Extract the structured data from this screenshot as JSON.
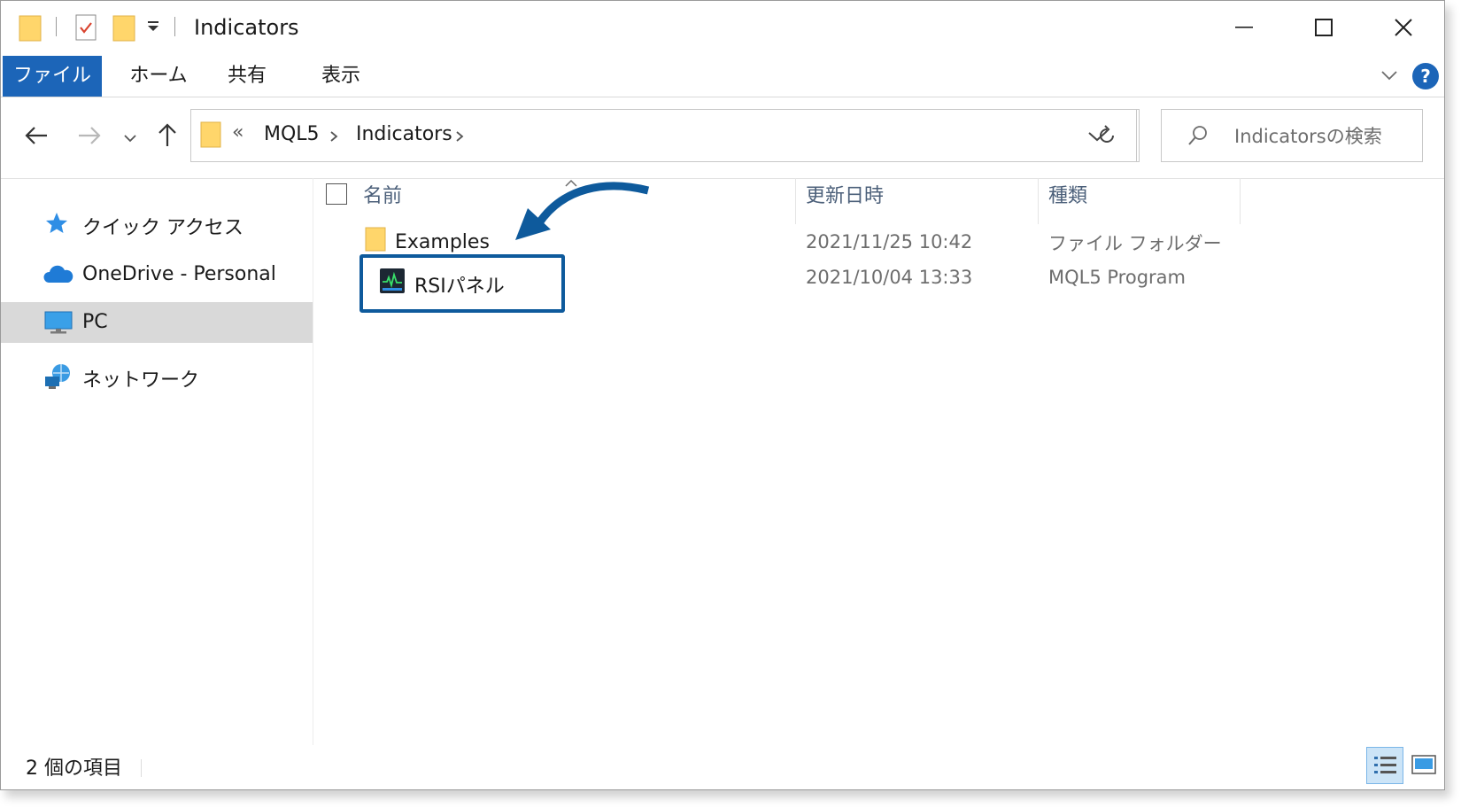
{
  "window": {
    "title": "Indicators"
  },
  "ribbon": {
    "tabs": [
      "ファイル",
      "ホーム",
      "共有",
      "表示"
    ],
    "active_tab": "ファイル",
    "help": "?"
  },
  "nav": {
    "path": [
      "MQL5",
      "Indicators"
    ],
    "overflow": "«",
    "search_placeholder": "Indicatorsの検索"
  },
  "sidebar": {
    "items": [
      {
        "label": "クイック アクセス",
        "icon": "star-icon"
      },
      {
        "label": "OneDrive - Personal",
        "icon": "cloud-icon"
      },
      {
        "label": "PC",
        "icon": "monitor-icon",
        "selected": true
      },
      {
        "label": "ネットワーク",
        "icon": "network-icon"
      }
    ]
  },
  "columns": [
    "名前",
    "更新日時",
    "種類"
  ],
  "files": [
    {
      "name": "Examples",
      "date": "2021/11/25 10:42",
      "type": "ファイル フォルダー",
      "icon": "folder-icon"
    },
    {
      "name": "RSIパネル",
      "date": "2021/10/04 13:33",
      "type": "MQL5 Program",
      "icon": "indicator-program-icon",
      "highlighted": true
    }
  ],
  "status": {
    "item_count": "2 個の項目"
  },
  "colors": {
    "accent": "#1c65b8",
    "highlight_border": "#0e5a9c",
    "arrow": "#0e5a9c",
    "selected_bg": "#d9d9d9"
  }
}
